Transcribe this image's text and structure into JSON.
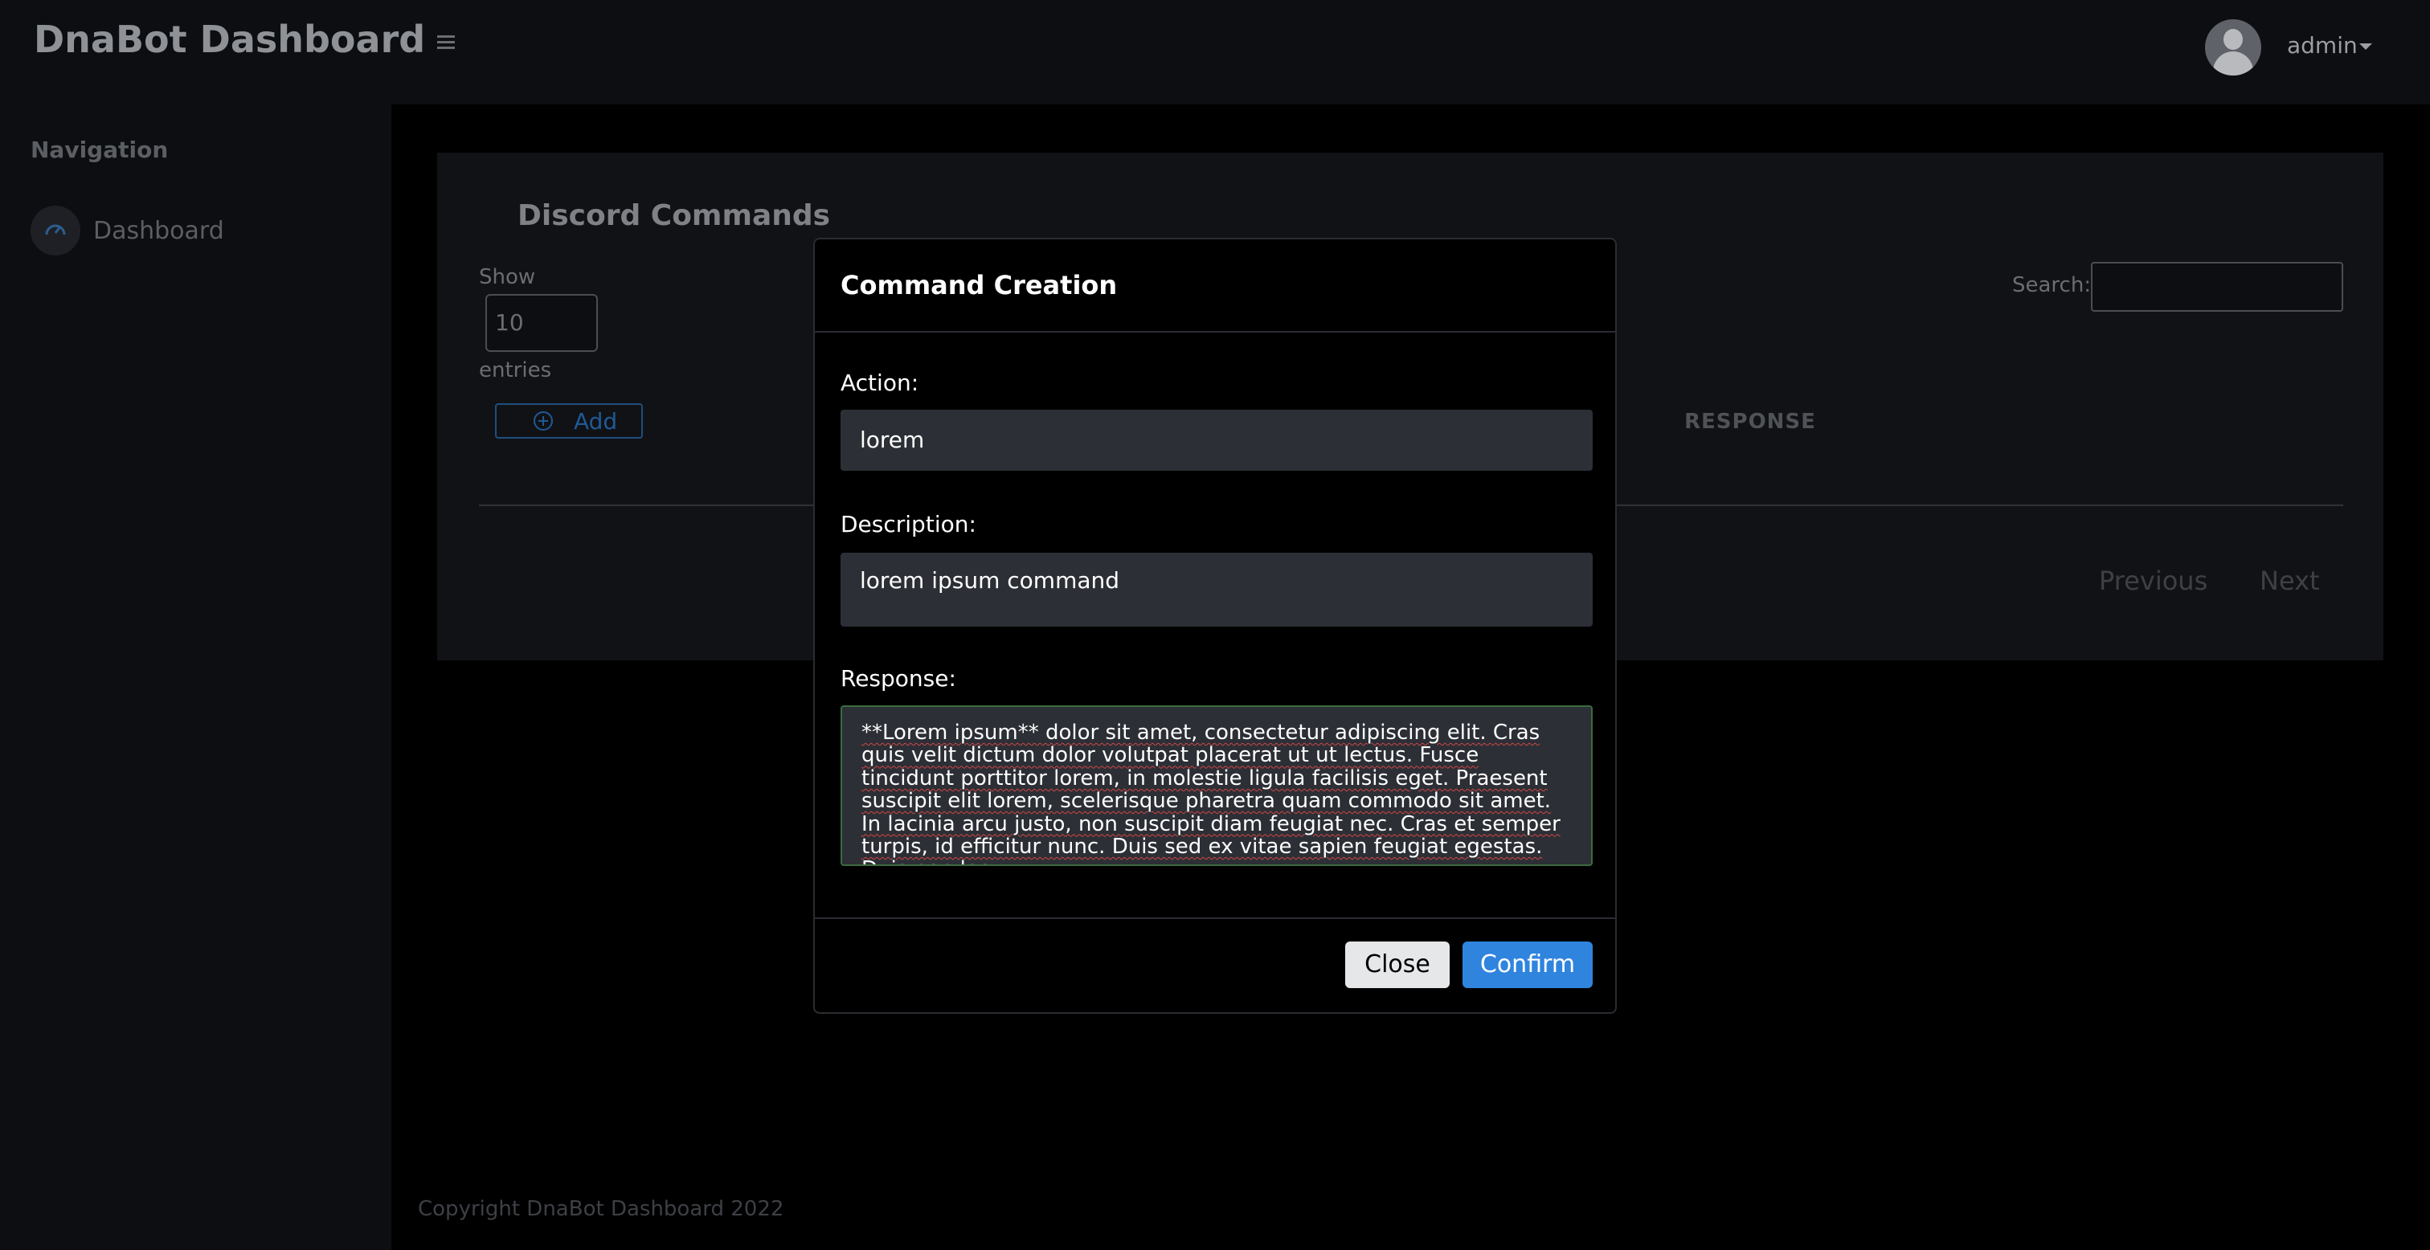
{
  "header": {
    "brand": "DnaBot Dashboard",
    "user": "admin"
  },
  "sidebar": {
    "heading": "Navigation",
    "items": [
      {
        "label": "Dashboard",
        "icon": "gauge-icon"
      }
    ]
  },
  "main": {
    "card_title": "Discord Commands",
    "show_label": "Show",
    "entries_value": "10",
    "entries_label": "entries",
    "add_label": "Add",
    "search_label": "Search:",
    "column_header": "RESPONSE",
    "pagination": {
      "previous": "Previous",
      "next": "Next"
    }
  },
  "footer": {
    "text": "Copyright DnaBot Dashboard 2022"
  },
  "modal": {
    "title": "Command Creation",
    "action_label": "Action:",
    "action_value": "lorem",
    "description_label": "Description:",
    "description_value": "lorem ipsum command",
    "response_label": "Response:",
    "response_value": "**Lorem ipsum** dolor sit amet, consectetur adipiscing elit. Cras quis velit dictum dolor volutpat placerat ut ut lectus. Fusce tincidunt porttitor lorem, in molestie ligula facilisis eget. Praesent suscipit elit lorem, scelerisque pharetra quam commodo sit amet. In lacinia arcu justo, non suscipit diam feugiat nec. Cras et semper turpis, id efficitur nunc. Duis sed ex vitae sapien feugiat egestas. Duis non leo",
    "close_label": "Close",
    "confirm_label": "Confirm"
  },
  "colors": {
    "accent": "#2f84de",
    "background": "#000000",
    "panel": "#111215"
  }
}
